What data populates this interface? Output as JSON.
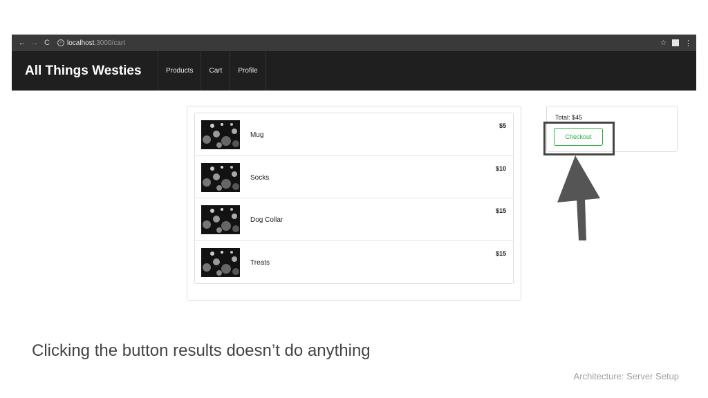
{
  "browser": {
    "back_icon": "←",
    "forward_icon": "→",
    "reload_icon": "C",
    "url_host": "localhost",
    "url_path": ":3000/cart",
    "star_icon": "☆",
    "menu_icon": "⋮"
  },
  "nav": {
    "brand": "All Things Westies",
    "links": [
      "Products",
      "Cart",
      "Profile"
    ]
  },
  "cart": {
    "items": [
      {
        "name": "Mug",
        "price": "$5"
      },
      {
        "name": "Socks",
        "price": "$10"
      },
      {
        "name": "Dog Collar",
        "price": "$15"
      },
      {
        "name": "Treats",
        "price": "$15"
      }
    ]
  },
  "summary": {
    "total": "Total: $45",
    "checkout_label": "Checkout",
    "accent_color": "#27ae40",
    "highlight_color": "#444444"
  },
  "slide": {
    "caption": "Clicking the button results doesn’t do anything",
    "footer": "Architecture: Server Setup"
  }
}
